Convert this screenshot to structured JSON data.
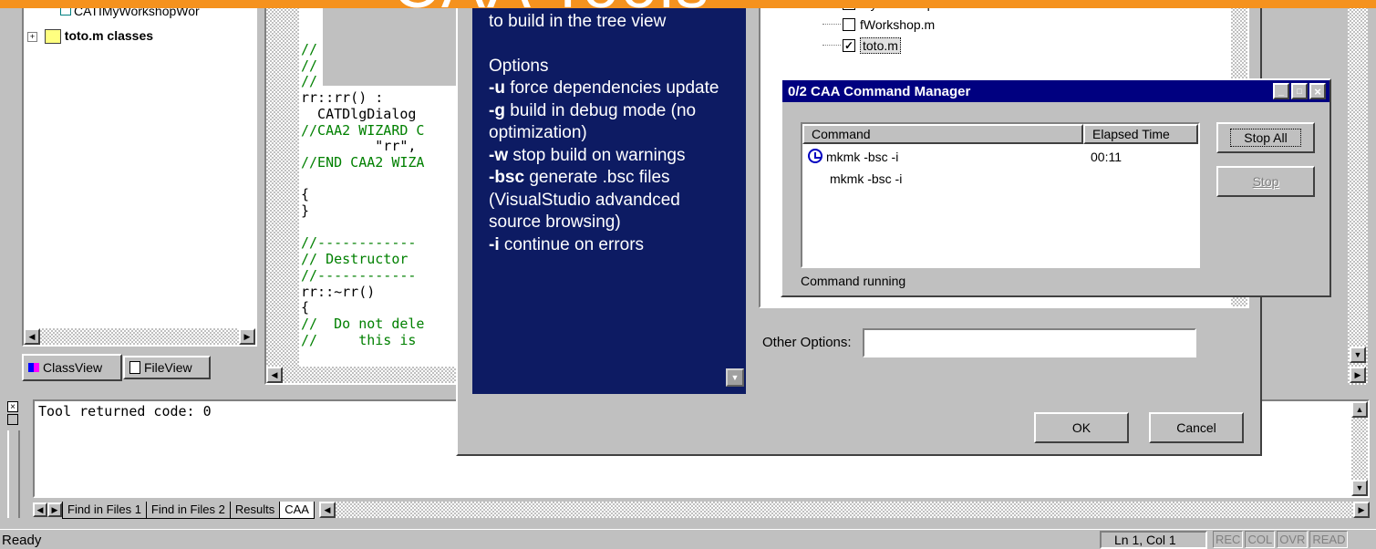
{
  "banner": {
    "text": "CAA Tools",
    "color": "#f5921e"
  },
  "class_tree": {
    "items": [
      {
        "label": "CATIMyWorkshopWor",
        "bold": false
      },
      {
        "label": "toto.m classes",
        "bold": true
      }
    ],
    "tabs": [
      {
        "label": "ClassView"
      },
      {
        "label": "FileView"
      }
    ]
  },
  "code": {
    "lines": [
      {
        "text": "//",
        "color": "green"
      },
      {
        "text": "//",
        "color": "green"
      },
      {
        "text": "//",
        "color": "green"
      },
      {
        "text": "rr::rr() :",
        "color": "black"
      },
      {
        "text": "  CATDlgDialog",
        "color": "black"
      },
      {
        "text": "//CAA2 WIZARD C",
        "color": "green"
      },
      {
        "text": "         \"rr\",",
        "color": "black"
      },
      {
        "text": "//END CAA2 WIZA",
        "color": "green"
      },
      {
        "text": "",
        "color": "black"
      },
      {
        "text": "{",
        "color": "black"
      },
      {
        "text": "}",
        "color": "black"
      },
      {
        "text": "",
        "color": "black"
      },
      {
        "text": "//------------",
        "color": "green"
      },
      {
        "text": "// Destructor",
        "color": "green"
      },
      {
        "text": "//------------",
        "color": "green"
      },
      {
        "text": "rr::~rr()",
        "color": "black"
      },
      {
        "text": "{",
        "color": "black"
      },
      {
        "text": "//  Do not dele",
        "color": "green"
      },
      {
        "text": "//     this is",
        "color": "green"
      }
    ]
  },
  "help_panel": {
    "intro": "to build in the tree view",
    "heading": "Options",
    "options": [
      {
        "flag": "-u",
        "desc": " force dependencies update"
      },
      {
        "flag": "-g",
        "desc": " build in debug mode (no optimization)"
      },
      {
        "flag": "-w",
        "desc": " stop build on warnings"
      },
      {
        "flag": "-bsc",
        "desc": " generate .bsc files (VisualStudio advandced source browsing)"
      },
      {
        "flag": "-i",
        "desc": " continue on errors"
      }
    ]
  },
  "build_dialog": {
    "modules": [
      {
        "label": "MyWorkshop.m",
        "checked": true
      },
      {
        "label": "fWorkshop.m",
        "checked": false
      },
      {
        "label": "toto.m",
        "checked": true
      }
    ],
    "other_options_label": "Other Options:",
    "other_options_value": "",
    "ok_label": "OK",
    "cancel_label": "Cancel"
  },
  "command_manager": {
    "title": "0/2 CAA Command Manager",
    "columns": [
      "Command",
      "Elapsed Time"
    ],
    "rows": [
      {
        "command": "mkmk  -bsc -i",
        "elapsed": "00:11",
        "running": true
      },
      {
        "command": "mkmk  -bsc -i",
        "elapsed": "",
        "running": false
      }
    ],
    "stop_all_label": "Stop All",
    "stop_label": "Stop",
    "status": "Command running",
    "title_bar_color": "#000080"
  },
  "output": {
    "text": "Tool returned code:  0",
    "tabs": [
      "Find in Files 1",
      "Find in Files 2",
      "Results",
      "CAA"
    ]
  },
  "status_bar": {
    "ready": "Ready",
    "position": "Ln 1, Col 1",
    "indicators": [
      "REC",
      "COL",
      "OVR",
      "READ"
    ]
  }
}
